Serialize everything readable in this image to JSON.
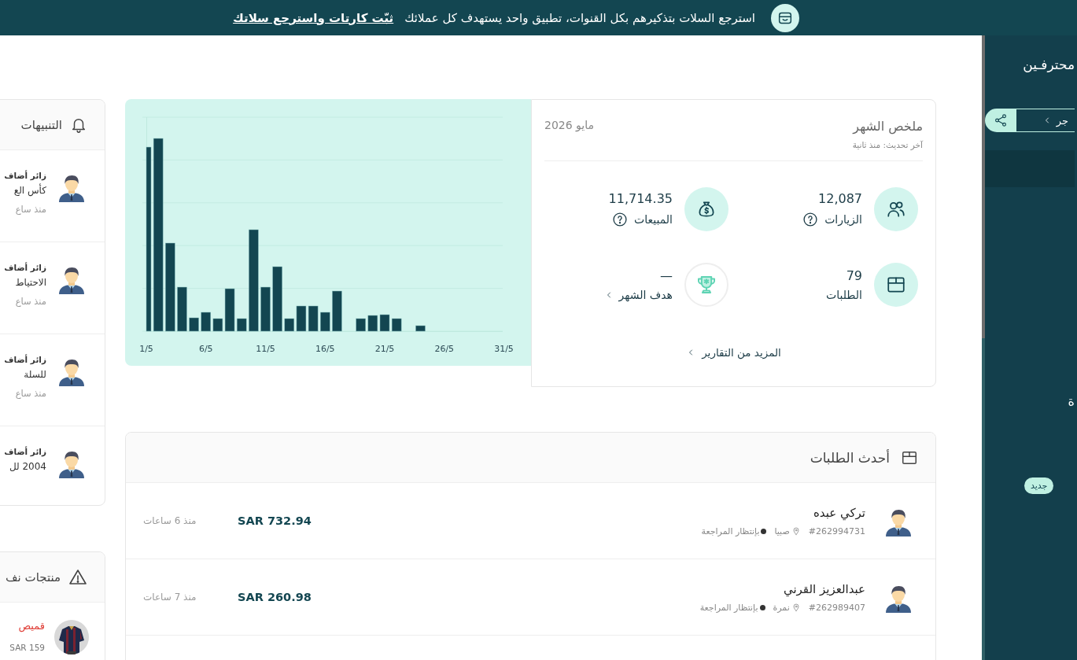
{
  "banner": {
    "message": "استرجع السلات بتذكيرهم بكل القنوات، تطبيق واحد يستهدف كل عملائك",
    "link": "ثبّت كارتات واسترجع سلاتك"
  },
  "notifications": {
    "title": "التنبيهات",
    "items": [
      {
        "title": "زائر أضاف",
        "detail": "كأس الع",
        "time": "منذ ساع"
      },
      {
        "title": "زائر أضاف",
        "detail": "الاحتياط",
        "time": "منذ ساع"
      },
      {
        "title": "زائر أضاف",
        "detail": "للسلة",
        "time": "منذ ساع"
      },
      {
        "title": "زائر أضاف",
        "detail": "2004 لل"
      }
    ]
  },
  "low_stock": {
    "title": "منتجات نف",
    "items": [
      {
        "name": "قميص",
        "price": "SAR 159"
      }
    ]
  },
  "chart": {
    "x_labels": [
      "31/5",
      "26/5",
      "21/5",
      "16/5",
      "11/5",
      "6/5",
      "1/5"
    ]
  },
  "summary": {
    "title": "ملخص الشهر",
    "updated": "آخر تحديث: منذ ثانية",
    "month": "مايو 2026",
    "stats": [
      {
        "kind": "visits",
        "value": "12,087",
        "label": "الزيارات",
        "help": true,
        "link": false
      },
      {
        "kind": "sales",
        "value": "11,714.35",
        "label": "المبيعات",
        "help": true,
        "link": false
      },
      {
        "kind": "orders",
        "value": "79",
        "label": "الطلبات",
        "help": false,
        "link": false
      },
      {
        "kind": "goal",
        "value": "—",
        "label": "هدف الشهر",
        "help": false,
        "link": true
      }
    ],
    "more_link": "المزيد من التقارير"
  },
  "orders": {
    "title": "أحدث الطلبات",
    "rows": [
      {
        "customer": "تركي عبده",
        "number": "#262994731",
        "city": "صبيا",
        "status": "بإنتظار المراجعة",
        "amount": "SAR 732.94",
        "time": "منذ 6 ساعات"
      },
      {
        "customer": "عبدالعزيز القرني",
        "number": "#262989407",
        "city": "نمرة",
        "status": "بإنتظار المراجعة",
        "amount": "SAR 260.98",
        "time": "منذ 7 ساعات"
      }
    ]
  },
  "sidebar": {
    "title": "محترفـين",
    "share_button": "جر",
    "fragment": "ة",
    "badge": "جديد"
  }
}
